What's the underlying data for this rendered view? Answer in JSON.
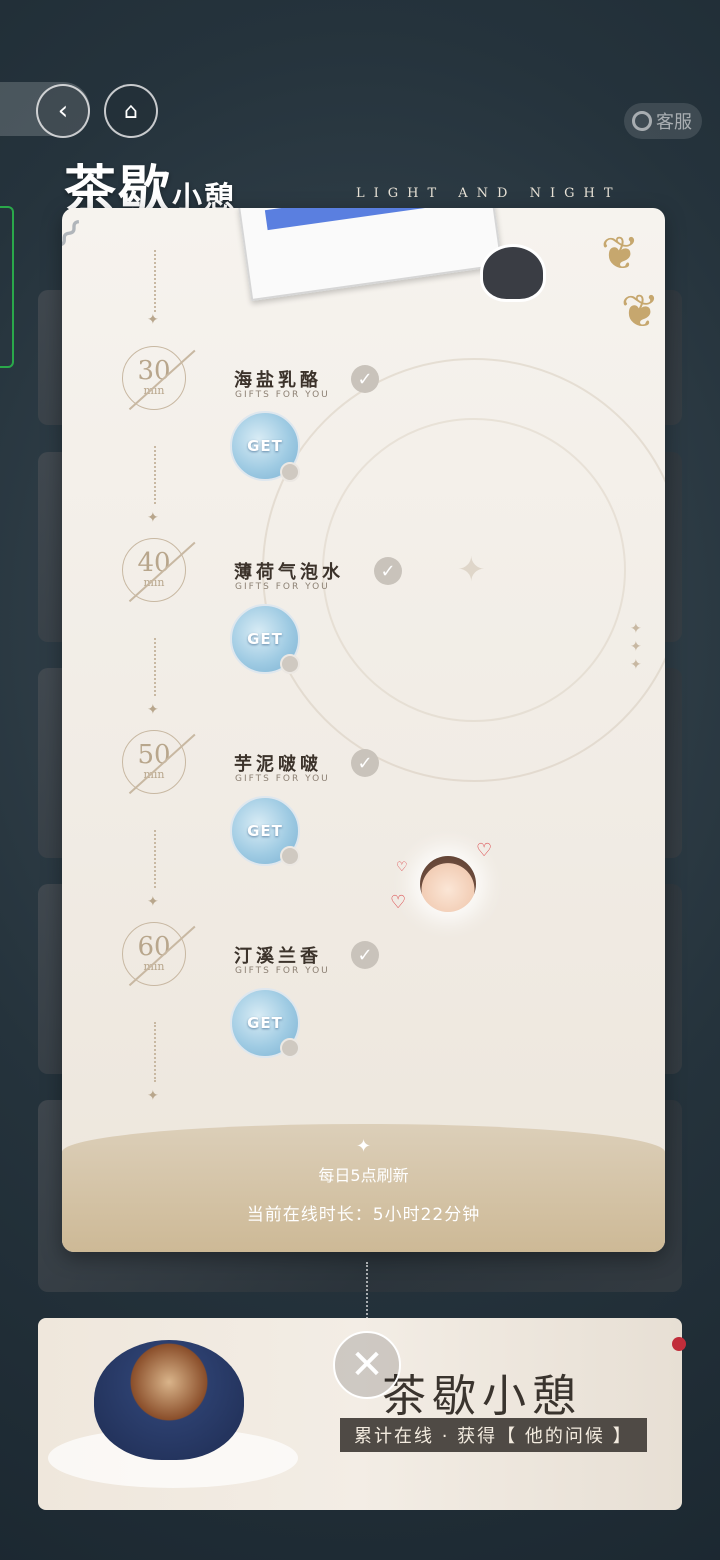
{
  "header": {
    "brand": "茶歇",
    "brand_small": "小憩",
    "tagline": "LIGHT AND NIGHT",
    "kefu": "客服"
  },
  "milestones": [
    {
      "minutes": "30",
      "unit": "min",
      "name": "海盐乳酪",
      "sub": "GIFTS FOR YOU",
      "reward": "GET",
      "claimed": true
    },
    {
      "minutes": "40",
      "unit": "min",
      "name": "薄荷气泡水",
      "sub": "GIFTS FOR YOU",
      "reward": "GET",
      "claimed": true
    },
    {
      "minutes": "50",
      "unit": "min",
      "name": "芋泥啵啵",
      "sub": "GIFTS FOR YOU",
      "reward": "GET",
      "claimed": true
    },
    {
      "minutes": "60",
      "unit": "min",
      "name": "汀溪兰香",
      "sub": "GIFTS FOR YOU",
      "reward": "GET",
      "claimed": true
    }
  ],
  "footer": {
    "refresh": "每日5点刷新",
    "online": "当前在线时长：5小时22分钟"
  },
  "banner": {
    "title": "茶歇小憩",
    "subtitle": "累计在线 · 获得【 他的问候 】"
  }
}
